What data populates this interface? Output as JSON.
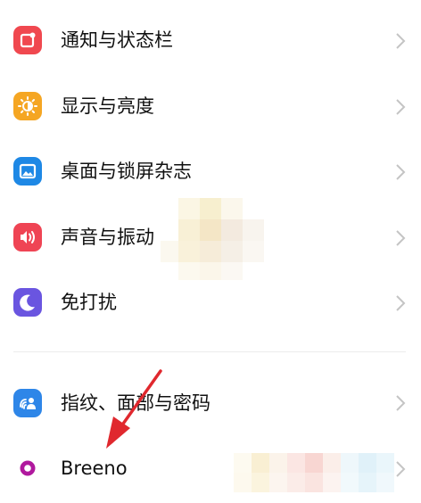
{
  "settings": {
    "items": [
      {
        "label": "通知与状态栏",
        "icon": "notification-icon",
        "color": "#f0484f"
      },
      {
        "label": "显示与亮度",
        "icon": "brightness-icon",
        "color": "#f5a623"
      },
      {
        "label": "桌面与锁屏杂志",
        "icon": "wallpaper-icon",
        "color": "#1e88e5"
      },
      {
        "label": "声音与振动",
        "icon": "sound-icon",
        "color": "#ef4454"
      },
      {
        "label": "免打扰",
        "icon": "moon-icon",
        "color": "#6a55e0"
      },
      {
        "label": "指纹、面部与密码",
        "icon": "fingerprint-face-icon",
        "color": "#2e86e8"
      },
      {
        "label": "Breeno",
        "icon": "breeno-icon",
        "color": "#b0199e"
      }
    ]
  },
  "colors": {
    "background": "#ffffff",
    "text": "#111111",
    "chevron": "#c4c4c4",
    "arrow": "#e0282e"
  }
}
